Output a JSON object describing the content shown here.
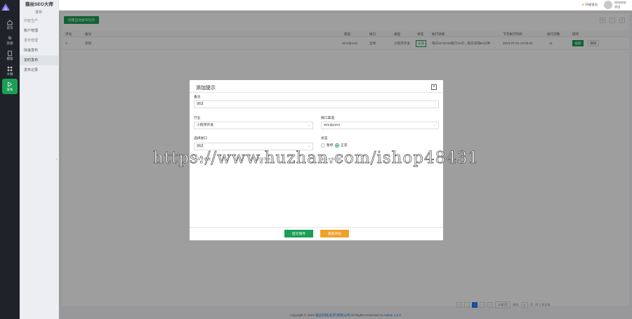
{
  "brand": "猫丝SEO大师",
  "rail": [
    {
      "icon": "home-icon",
      "label": "首页"
    },
    {
      "icon": "link-icon",
      "label": "资源"
    },
    {
      "icon": "book-icon",
      "label": "模版"
    },
    {
      "icon": "grid-icon",
      "label": "大纲"
    },
    {
      "icon": "send-icon",
      "label": "发布",
      "active": true
    }
  ],
  "sidebar": {
    "header": "发布",
    "items": [
      {
        "label": "内容生产",
        "style": "faded"
      },
      {
        "label": "账户管理",
        "style": "dark"
      },
      {
        "label": "发布管理",
        "style": "faded"
      },
      {
        "label": "快速发布",
        "style": "dark"
      },
      {
        "label": "定时发布",
        "style": "selected"
      },
      {
        "label": "发布记录",
        "style": "dark"
      }
    ]
  },
  "topbar": {
    "upgrade_label": "升级会员",
    "user_name": "哈哈哈哈",
    "user_action": "退出"
  },
  "toolbar": {
    "create_label": "创建自动发布任务"
  },
  "table": {
    "headers": [
      "序号",
      "备注",
      "渠道",
      "接口",
      "类型",
      "状态",
      "执行效果",
      "下次执行时间",
      "执行次数",
      "操作"
    ],
    "rows": [
      {
        "index": "1",
        "note": "测试",
        "channel": "Wordpress",
        "api": "全球",
        "type": "小程序开发",
        "status": "正常",
        "effect": "每日10:00:00执行10次，每次间隔60分钟",
        "next_time": "2023-07-04 10:00:00",
        "count": "11",
        "edit_label": "编辑",
        "delete_label": "删除"
      }
    ]
  },
  "pagination": {
    "current": "1",
    "per_page": "10条/页",
    "goto_label": "前往",
    "page_input": "1",
    "page_unit": "页",
    "total": "共 1 条记录"
  },
  "footer": {
    "text": "copyright © 2023",
    "company": "猫丝科技(北京)有限公司",
    "rights": "All Rights Reserved",
    "version": "ALAdmin 1.2.0"
  },
  "modal": {
    "title": "添加提示",
    "fields": {
      "note_label": "备注",
      "note_value": "测试",
      "channel_label": "行业",
      "channel_value": "小程序开发",
      "api_label": "接口渠道",
      "api_value": "Wordpress",
      "select_label": "选择接口",
      "select_value": "测试",
      "status_label": "状态",
      "status_off": "暂停",
      "status_on": "正常",
      "hidden_1": "发布文章数",
      "hidden_2": "内容字数",
      "hidden_3": "发布文章标题"
    },
    "save_label": "提交保存",
    "reset_label": "重新开始"
  },
  "watermark": "https://www.huzhan.com/ishop48431"
}
